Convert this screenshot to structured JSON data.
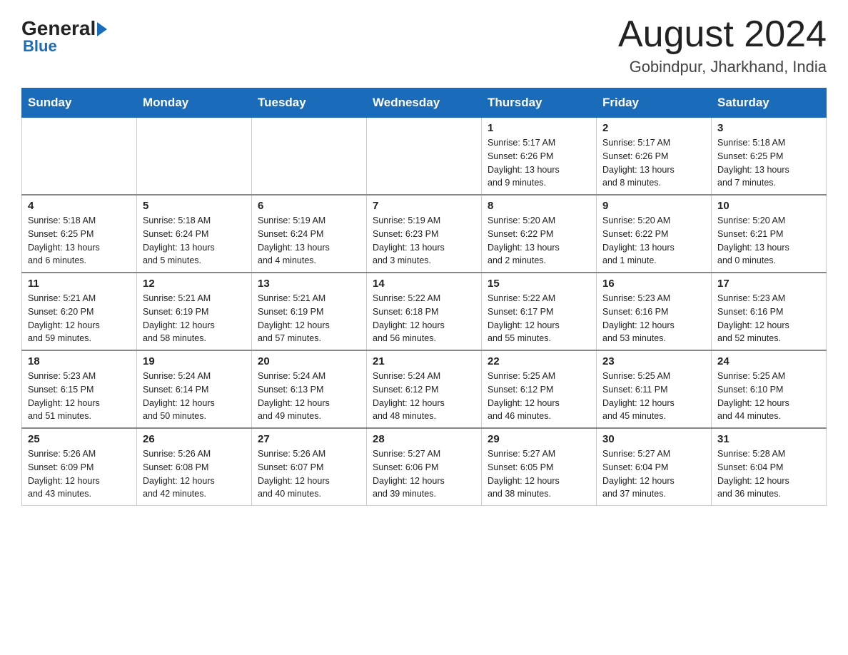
{
  "header": {
    "logo": {
      "general": "General",
      "blue": "Blue"
    },
    "title": "August 2024",
    "location": "Gobindpur, Jharkhand, India"
  },
  "days_of_week": [
    "Sunday",
    "Monday",
    "Tuesday",
    "Wednesday",
    "Thursday",
    "Friday",
    "Saturday"
  ],
  "weeks": [
    {
      "cells": [
        {
          "day": "",
          "info": ""
        },
        {
          "day": "",
          "info": ""
        },
        {
          "day": "",
          "info": ""
        },
        {
          "day": "",
          "info": ""
        },
        {
          "day": "1",
          "info": "Sunrise: 5:17 AM\nSunset: 6:26 PM\nDaylight: 13 hours\nand 9 minutes."
        },
        {
          "day": "2",
          "info": "Sunrise: 5:17 AM\nSunset: 6:26 PM\nDaylight: 13 hours\nand 8 minutes."
        },
        {
          "day": "3",
          "info": "Sunrise: 5:18 AM\nSunset: 6:25 PM\nDaylight: 13 hours\nand 7 minutes."
        }
      ]
    },
    {
      "cells": [
        {
          "day": "4",
          "info": "Sunrise: 5:18 AM\nSunset: 6:25 PM\nDaylight: 13 hours\nand 6 minutes."
        },
        {
          "day": "5",
          "info": "Sunrise: 5:18 AM\nSunset: 6:24 PM\nDaylight: 13 hours\nand 5 minutes."
        },
        {
          "day": "6",
          "info": "Sunrise: 5:19 AM\nSunset: 6:24 PM\nDaylight: 13 hours\nand 4 minutes."
        },
        {
          "day": "7",
          "info": "Sunrise: 5:19 AM\nSunset: 6:23 PM\nDaylight: 13 hours\nand 3 minutes."
        },
        {
          "day": "8",
          "info": "Sunrise: 5:20 AM\nSunset: 6:22 PM\nDaylight: 13 hours\nand 2 minutes."
        },
        {
          "day": "9",
          "info": "Sunrise: 5:20 AM\nSunset: 6:22 PM\nDaylight: 13 hours\nand 1 minute."
        },
        {
          "day": "10",
          "info": "Sunrise: 5:20 AM\nSunset: 6:21 PM\nDaylight: 13 hours\nand 0 minutes."
        }
      ]
    },
    {
      "cells": [
        {
          "day": "11",
          "info": "Sunrise: 5:21 AM\nSunset: 6:20 PM\nDaylight: 12 hours\nand 59 minutes."
        },
        {
          "day": "12",
          "info": "Sunrise: 5:21 AM\nSunset: 6:19 PM\nDaylight: 12 hours\nand 58 minutes."
        },
        {
          "day": "13",
          "info": "Sunrise: 5:21 AM\nSunset: 6:19 PM\nDaylight: 12 hours\nand 57 minutes."
        },
        {
          "day": "14",
          "info": "Sunrise: 5:22 AM\nSunset: 6:18 PM\nDaylight: 12 hours\nand 56 minutes."
        },
        {
          "day": "15",
          "info": "Sunrise: 5:22 AM\nSunset: 6:17 PM\nDaylight: 12 hours\nand 55 minutes."
        },
        {
          "day": "16",
          "info": "Sunrise: 5:23 AM\nSunset: 6:16 PM\nDaylight: 12 hours\nand 53 minutes."
        },
        {
          "day": "17",
          "info": "Sunrise: 5:23 AM\nSunset: 6:16 PM\nDaylight: 12 hours\nand 52 minutes."
        }
      ]
    },
    {
      "cells": [
        {
          "day": "18",
          "info": "Sunrise: 5:23 AM\nSunset: 6:15 PM\nDaylight: 12 hours\nand 51 minutes."
        },
        {
          "day": "19",
          "info": "Sunrise: 5:24 AM\nSunset: 6:14 PM\nDaylight: 12 hours\nand 50 minutes."
        },
        {
          "day": "20",
          "info": "Sunrise: 5:24 AM\nSunset: 6:13 PM\nDaylight: 12 hours\nand 49 minutes."
        },
        {
          "day": "21",
          "info": "Sunrise: 5:24 AM\nSunset: 6:12 PM\nDaylight: 12 hours\nand 48 minutes."
        },
        {
          "day": "22",
          "info": "Sunrise: 5:25 AM\nSunset: 6:12 PM\nDaylight: 12 hours\nand 46 minutes."
        },
        {
          "day": "23",
          "info": "Sunrise: 5:25 AM\nSunset: 6:11 PM\nDaylight: 12 hours\nand 45 minutes."
        },
        {
          "day": "24",
          "info": "Sunrise: 5:25 AM\nSunset: 6:10 PM\nDaylight: 12 hours\nand 44 minutes."
        }
      ]
    },
    {
      "cells": [
        {
          "day": "25",
          "info": "Sunrise: 5:26 AM\nSunset: 6:09 PM\nDaylight: 12 hours\nand 43 minutes."
        },
        {
          "day": "26",
          "info": "Sunrise: 5:26 AM\nSunset: 6:08 PM\nDaylight: 12 hours\nand 42 minutes."
        },
        {
          "day": "27",
          "info": "Sunrise: 5:26 AM\nSunset: 6:07 PM\nDaylight: 12 hours\nand 40 minutes."
        },
        {
          "day": "28",
          "info": "Sunrise: 5:27 AM\nSunset: 6:06 PM\nDaylight: 12 hours\nand 39 minutes."
        },
        {
          "day": "29",
          "info": "Sunrise: 5:27 AM\nSunset: 6:05 PM\nDaylight: 12 hours\nand 38 minutes."
        },
        {
          "day": "30",
          "info": "Sunrise: 5:27 AM\nSunset: 6:04 PM\nDaylight: 12 hours\nand 37 minutes."
        },
        {
          "day": "31",
          "info": "Sunrise: 5:28 AM\nSunset: 6:04 PM\nDaylight: 12 hours\nand 36 minutes."
        }
      ]
    }
  ]
}
